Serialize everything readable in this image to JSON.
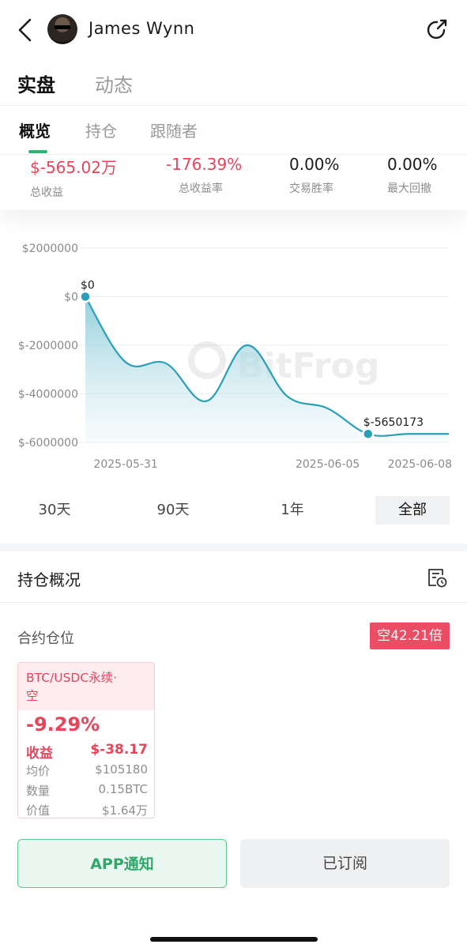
{
  "header": {
    "username": "James Wynn",
    "back_icon": "chevron-left-icon",
    "share_icon": "share-icon"
  },
  "main_tabs": [
    {
      "label": "实盘",
      "active": true
    },
    {
      "label": "动态",
      "active": false
    }
  ],
  "sub_tabs": [
    {
      "label": "概览",
      "active": true
    },
    {
      "label": "持仓",
      "active": false
    },
    {
      "label": "跟随者",
      "active": false
    }
  ],
  "stats": [
    {
      "value": "$-565.02万",
      "label": "总收益"
    },
    {
      "value": "-176.39%",
      "label": "总收益率"
    },
    {
      "value": "0.00%",
      "label": "交易胜率"
    },
    {
      "value": "0.00%",
      "label": "最大回撤"
    }
  ],
  "colors": {
    "accent_green": "#2bb673",
    "loss_red": "#e8445a",
    "chart_line": "#2a9fb8"
  },
  "chart_data": {
    "type": "area",
    "y_ticks": [
      "$2000000",
      "$0",
      "$-2000000",
      "$-4000000",
      "$-6000000"
    ],
    "y_tick_values": [
      2000000,
      0,
      -2000000,
      -4000000,
      -6000000
    ],
    "ylim": [
      -6000000,
      2000000
    ],
    "x_ticks": [
      "2025-05-31",
      "2025-06-05",
      "2025-06-08"
    ],
    "x": [
      "2025-05-30",
      "2025-05-31",
      "2025-06-01",
      "2025-06-02",
      "2025-06-03",
      "2025-06-04",
      "2025-06-05",
      "2025-06-06",
      "2025-06-07",
      "2025-06-08"
    ],
    "values": [
      0,
      -2700000,
      -2750000,
      -4300000,
      -2000000,
      -4100000,
      -4600000,
      -5650173,
      -5650173,
      -5650173
    ],
    "annotations": [
      {
        "text": "$0",
        "x": "2025-05-30",
        "y": 0
      },
      {
        "text": "$-5650173",
        "x": "2025-06-06",
        "y": -5650173
      }
    ],
    "watermark": "BitFrog",
    "grid": true
  },
  "ranges": [
    {
      "label": "30天",
      "active": false
    },
    {
      "label": "90天",
      "active": false
    },
    {
      "label": "1年",
      "active": false
    },
    {
      "label": "全部",
      "active": true
    }
  ],
  "positions": {
    "title": "持仓概况",
    "history_icon": "history-icon",
    "contract_label": "合约仓位",
    "leverage_badge": "空42.21倍",
    "card": {
      "symbol_line1": "BTC/USDC永续·",
      "symbol_line2": "空",
      "pnl_pct": "-9.29%",
      "pnl_label": "收益",
      "pnl_value": "$-38.17",
      "rows": [
        {
          "k": "均价",
          "v": "$105180"
        },
        {
          "k": "数量",
          "v": "0.15BTC"
        },
        {
          "k": "价值",
          "v": "$1.64万"
        }
      ]
    }
  },
  "buttons": {
    "app_notify": "APP通知",
    "subscribed": "已订阅"
  }
}
